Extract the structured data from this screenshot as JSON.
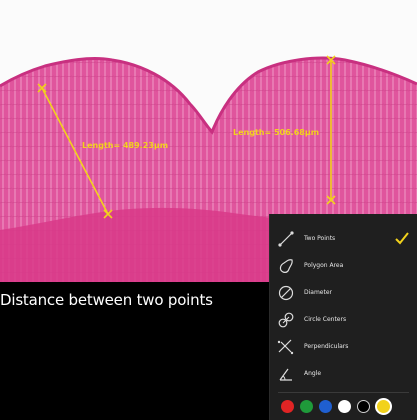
{
  "measurements": [
    {
      "label": "Length= 489.23μm"
    },
    {
      "label": "Length= 506.68μm"
    }
  ],
  "caption": "Distance between two points",
  "tools": [
    {
      "label": "Two Points",
      "icon": "two-points-line-icon",
      "selected": true
    },
    {
      "label": "Polygon Area",
      "icon": "polygon-area-icon",
      "selected": false
    },
    {
      "label": "Diameter",
      "icon": "diameter-icon",
      "selected": false
    },
    {
      "label": "Circle Centers",
      "icon": "circle-centers-icon",
      "selected": false
    },
    {
      "label": "Perpendiculars",
      "icon": "perpendiculars-icon",
      "selected": false
    },
    {
      "label": "Angle",
      "icon": "angle-icon",
      "selected": false
    }
  ],
  "colors": [
    "#e02424",
    "#1f9a3a",
    "#1f5fd0",
    "#ffffff",
    "#000000",
    "#f2d21c"
  ],
  "selected_color": "#f2d21c",
  "accent": "#f2d21c",
  "tissue_color": "#e14f9a"
}
